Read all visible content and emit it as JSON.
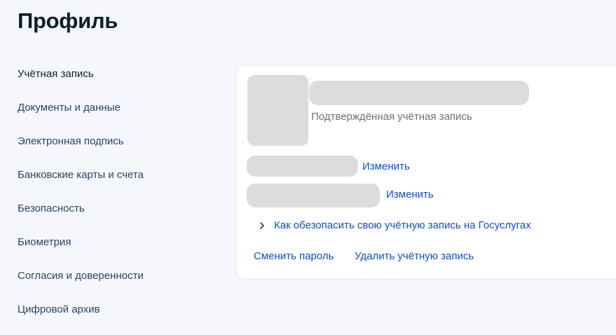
{
  "page": {
    "title": "Профиль"
  },
  "sidebar": {
    "items": [
      {
        "label": "Учётная запись",
        "active": true
      },
      {
        "label": "Документы и данные"
      },
      {
        "label": "Электронная подпись"
      },
      {
        "label": "Банковские карты и счета"
      },
      {
        "label": "Безопасность"
      },
      {
        "label": "Биометрия"
      },
      {
        "label": "Согласия и доверенности"
      },
      {
        "label": "Цифровой архив"
      }
    ]
  },
  "account": {
    "status": "Подтверждённая учётная запись",
    "edit_label_1": "Изменить",
    "edit_label_2": "Изменить",
    "security_link": "Как обезопасить свою учётную запись на Госуслугах",
    "change_password": "Сменить пароль",
    "delete_account": "Удалить учётную запись"
  },
  "colors": {
    "link": "#0d4cd3",
    "heading": "#0b1f33",
    "background": "#f5f7fc",
    "skeleton": "#dcdcdc"
  },
  "icons": {
    "security_chevron": "chevron-right-icon"
  }
}
